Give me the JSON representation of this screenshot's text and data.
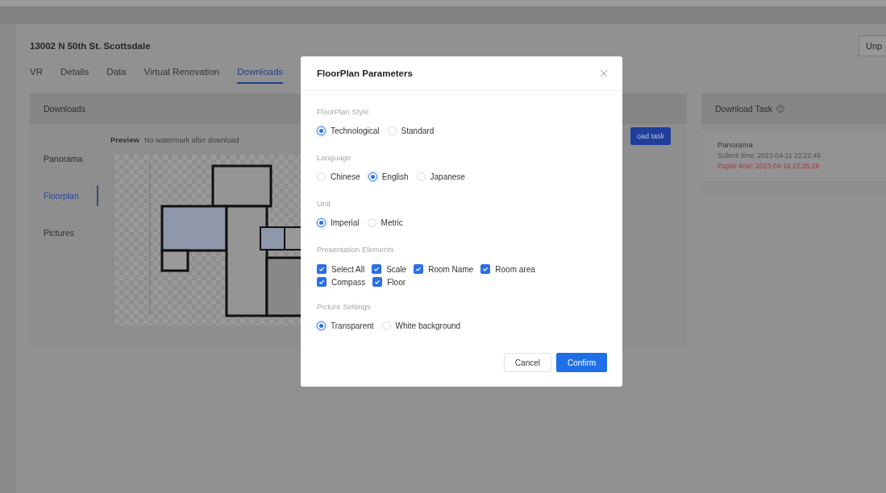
{
  "page": {
    "title": "13002 N 50th St. Scottsdale",
    "action_button": "Unp"
  },
  "tabs": [
    {
      "label": "VR",
      "selected": false
    },
    {
      "label": "Details",
      "selected": false
    },
    {
      "label": "Data",
      "selected": false
    },
    {
      "label": "Virtual Renovation",
      "selected": false
    },
    {
      "label": "Downloads",
      "selected": true
    }
  ],
  "downloads": {
    "title": "Downloads",
    "nav": [
      {
        "label": "Panorama",
        "selected": false
      },
      {
        "label": "Floorplan",
        "selected": true
      },
      {
        "label": "Pictures",
        "selected": false
      }
    ],
    "preview_label": "Preview",
    "preview_note": "No watermark after download",
    "task_button": "oad task"
  },
  "download_task": {
    "title": "Download Task",
    "items": [
      {
        "name": "Panorama",
        "submit_time": "Submit time: 2023-04-11 22:22:46",
        "expire_time": "Expire time: 2023-04-18 22:26:28"
      }
    ]
  },
  "dialog": {
    "title": "FloorPlan Parameters",
    "sections": [
      {
        "label": "FloorPlan Style",
        "kind": "radio",
        "options": [
          {
            "label": "Technological",
            "selected": true
          },
          {
            "label": "Standard",
            "selected": false
          }
        ]
      },
      {
        "label": "Language",
        "kind": "radio",
        "options": [
          {
            "label": "Chinese",
            "selected": false
          },
          {
            "label": "English",
            "selected": true
          },
          {
            "label": "Japanese",
            "selected": false
          }
        ]
      },
      {
        "label": "Unit",
        "kind": "radio",
        "options": [
          {
            "label": "Imperial",
            "selected": true
          },
          {
            "label": "Metric",
            "selected": false
          }
        ]
      },
      {
        "label": "Presentation Elements",
        "kind": "checkbox",
        "options": [
          {
            "label": "Select All",
            "checked": true
          },
          {
            "label": "Scale",
            "checked": true
          },
          {
            "label": "Room Name",
            "checked": true
          },
          {
            "label": "Room area",
            "checked": true
          },
          {
            "label": "Compass",
            "checked": true
          },
          {
            "label": "Floor",
            "checked": true
          }
        ]
      },
      {
        "label": "Picture Settings",
        "kind": "radio",
        "options": [
          {
            "label": "Transparent",
            "selected": true
          },
          {
            "label": "White background",
            "selected": false
          }
        ]
      }
    ],
    "buttons": [
      {
        "label": "Cancel",
        "kind": "secondary"
      },
      {
        "label": "Confirm",
        "kind": "primary"
      }
    ]
  }
}
